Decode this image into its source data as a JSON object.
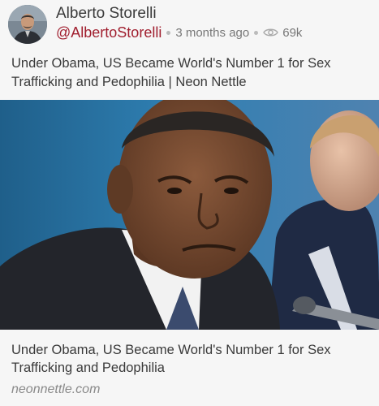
{
  "post": {
    "author": {
      "name": "Alberto Storelli",
      "handle": "@AlbertoStorelli",
      "avatar_icon": "user-avatar"
    },
    "time_ago": "3 months ago",
    "view_count": "69k",
    "text": "Under Obama, US Became World's Number 1 for Sex Trafficking and Pedophilia | Neon Nettle"
  },
  "link_card": {
    "image_subject": "photo-of-man-in-suit",
    "title": "Under Obama, US Became World's Number 1 for Sex Trafficking and Pedophilia",
    "domain": "neonnettle.com"
  },
  "colors": {
    "handle": "#a01e2e",
    "background": "#f6f6f6",
    "meta_text": "#777777"
  }
}
